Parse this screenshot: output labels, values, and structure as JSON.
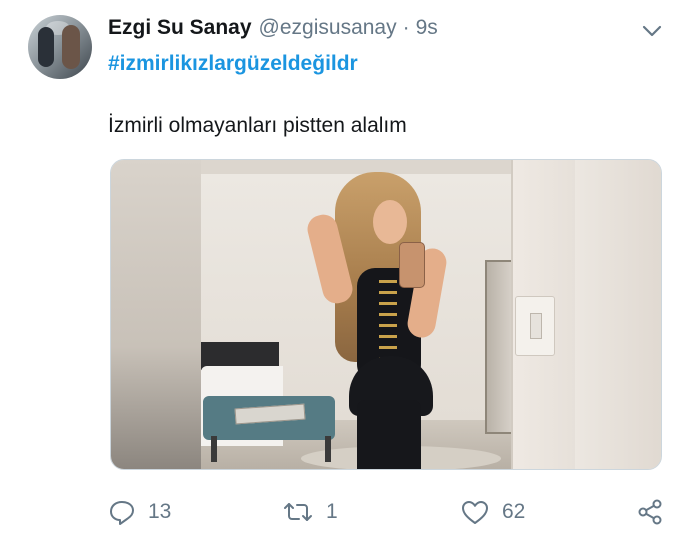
{
  "user": {
    "name": "Ezgi Su Sanay",
    "handle": "@ezgisusanay",
    "separator": "·",
    "time": "9s"
  },
  "tweet": {
    "hashtag": "#izmirlikızlargüzeldeğildr",
    "text": "İzmirli olmayanları pistten alalım"
  },
  "actions": {
    "reply_count": "13",
    "retweet_count": "1",
    "like_count": "62"
  },
  "icons": {
    "menu": "chevron-down-icon",
    "reply": "reply-icon",
    "retweet": "retweet-icon",
    "like": "heart-icon",
    "share": "share-icon"
  },
  "colors": {
    "text": "#14171a",
    "secondary": "#657786",
    "link": "#1b95e0",
    "border": "#ccd6dd"
  }
}
